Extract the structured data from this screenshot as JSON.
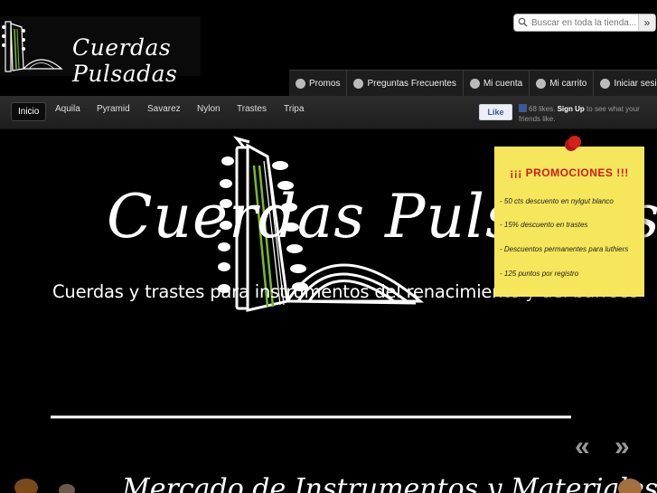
{
  "logo": {
    "text": "Cuerdas Pulsadas"
  },
  "search": {
    "placeholder": "Buscar en toda la tienda...",
    "button_label": "»"
  },
  "top_nav": [
    {
      "label": "Promos",
      "icon": "coin-icon"
    },
    {
      "label": "Preguntas Frecuentes",
      "icon": "question-icon"
    },
    {
      "label": "Mi cuenta",
      "icon": "user-icon"
    },
    {
      "label": "Mi carrito",
      "icon": "cart-icon"
    },
    {
      "label": "Iniciar sesión",
      "icon": "key-icon"
    }
  ],
  "main_nav": [
    "Inicio",
    "Aquila",
    "Pyramid",
    "Savarez",
    "Nylon",
    "Trastes",
    "Tripa"
  ],
  "facebook": {
    "like_label": "Like",
    "count_text": "68 likes.",
    "signup": "Sign Up",
    "rest": "to see what your friends like."
  },
  "hero": {
    "brand": "Cuerdas Pulsadas",
    "tagline": "Cuerdas y trastes para instrumentos del renacimiento y del barroco"
  },
  "promo": {
    "title": "¡¡¡ PROMOCIONES !!!",
    "items": [
      "- 50 cts descuento en nylgut blanco",
      "- 15% descuento en trastes",
      "- Descuentos permanentes para luthiers",
      "- 125 puntos por registro"
    ]
  },
  "slider": {
    "prev": "«",
    "next": "»"
  },
  "bottom_banner": {
    "text": "Mercado de Instrumentos y Materiales"
  },
  "colors": {
    "background": "#000000",
    "note": "#f6e65b",
    "promo_title": "#d11b1b",
    "accent_green": "#7ab929"
  }
}
